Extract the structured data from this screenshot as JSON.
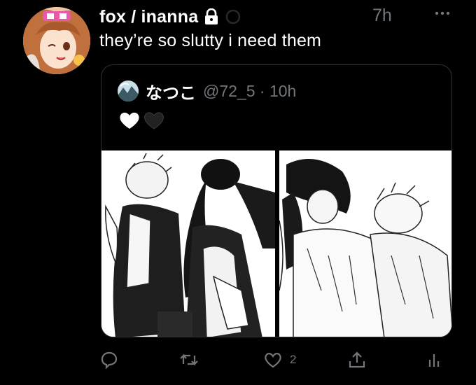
{
  "header": {
    "display_name": "fox / inanna",
    "time": "7h"
  },
  "tweet": {
    "text": "they’re so slutty i need them"
  },
  "quoted_tweet": {
    "name": "なつこ",
    "handle_time": "@72_5 · 10h",
    "emoji": [
      "white-heart",
      "black-heart"
    ]
  },
  "actions": {
    "like_count": "2"
  },
  "colors": {
    "background": "#000000",
    "text": "#ffffff",
    "muted": "#71767b",
    "border": "#2f3336"
  }
}
